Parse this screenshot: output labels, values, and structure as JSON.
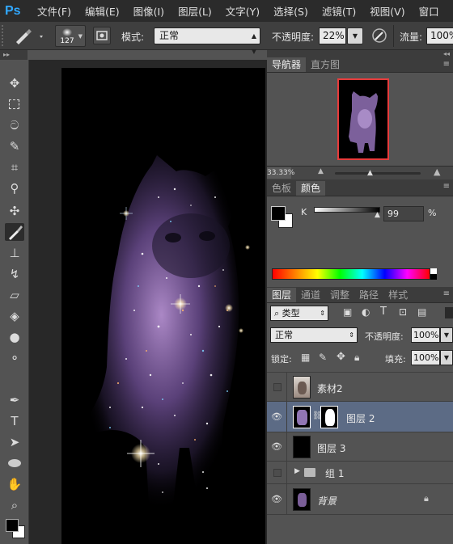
{
  "app": {
    "logo": "Ps"
  },
  "menu": [
    "文件(F)",
    "编辑(E)",
    "图像(I)",
    "图层(L)",
    "文字(Y)",
    "选择(S)",
    "滤镜(T)",
    "视图(V)",
    "窗口"
  ],
  "options": {
    "brush_size": "127",
    "mode_label": "模式:",
    "mode_value": "正常",
    "opacity_label": "不透明度:",
    "opacity_value": "22%",
    "flow_label": "流量:",
    "flow_value": "100%"
  },
  "navigator": {
    "tabs": [
      "导航器",
      "直方图"
    ],
    "zoom": "33.33%"
  },
  "color": {
    "tabs": [
      "色板",
      "颜色"
    ],
    "channel_label": "K",
    "value": "99",
    "unit": "%",
    "foreground": "#000000",
    "background": "#ffffff"
  },
  "layers": {
    "tabs": [
      "图层",
      "通道",
      "调整",
      "路径",
      "样式"
    ],
    "filter_label": "类型",
    "blend_mode": "正常",
    "opacity_label": "不透明度:",
    "opacity_value": "100%",
    "lock_label": "锁定:",
    "fill_label": "填充:",
    "fill_value": "100%",
    "items": [
      {
        "name": "素材2",
        "visible": false,
        "selected": false
      },
      {
        "name": "图层 2",
        "visible": true,
        "selected": true
      },
      {
        "name": "图层 3",
        "visible": true,
        "selected": false
      },
      {
        "name": "组 1",
        "visible": false,
        "selected": false
      },
      {
        "name": "背景",
        "visible": true,
        "selected": false
      }
    ]
  },
  "colors": {
    "accent": "#31a8ff",
    "selected_layer": "#5c6b85",
    "nav_frame": "#e83c3c"
  }
}
